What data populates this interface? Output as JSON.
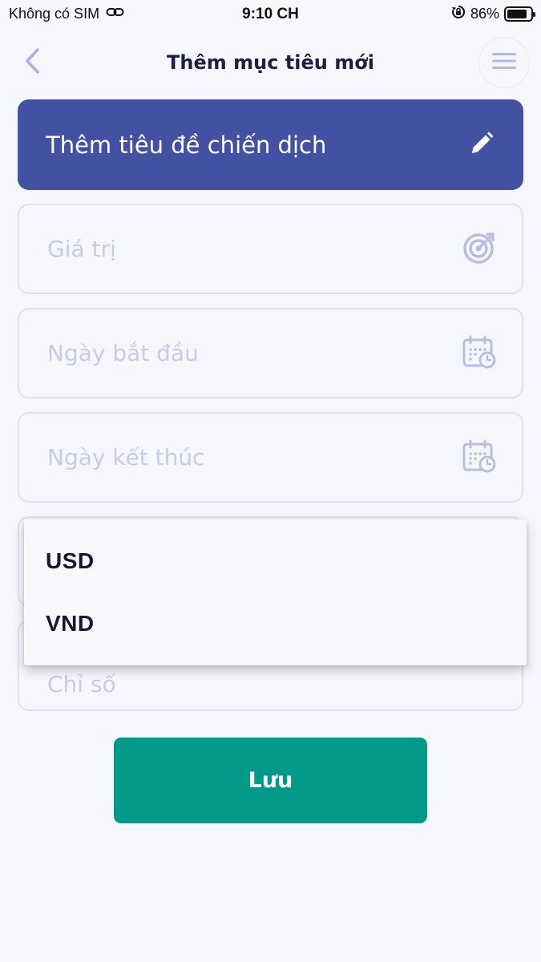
{
  "status_bar": {
    "carrier": "Không có SIM",
    "time": "9:10 CH",
    "battery_percent": "86%",
    "battery_level": 0.86,
    "icons": [
      "link-icon",
      "orientation-lock-icon",
      "battery-icon"
    ]
  },
  "header": {
    "title": "Thêm mục tiêu mới",
    "back_icon": "chevron-left-icon",
    "menu_icon": "hamburger-menu-icon"
  },
  "title_banner": {
    "text": "Thêm tiêu đề chiến dịch",
    "icon": "pencil-icon"
  },
  "fields": {
    "value_placeholder": "Giá trị",
    "start_date_placeholder": "Ngày bắt đầu",
    "end_date_placeholder": "Ngày kết thúc",
    "index_placeholder": "Chỉ số"
  },
  "currency_dropdown": {
    "options": [
      "USD",
      "VND"
    ]
  },
  "actions": {
    "save_label": "Lưu"
  },
  "colors": {
    "background": "#f6f7fd",
    "primary": "#4251a1",
    "save": "#019a88",
    "placeholder": "#c8cbe8",
    "icon_muted": "#b9bde0"
  }
}
